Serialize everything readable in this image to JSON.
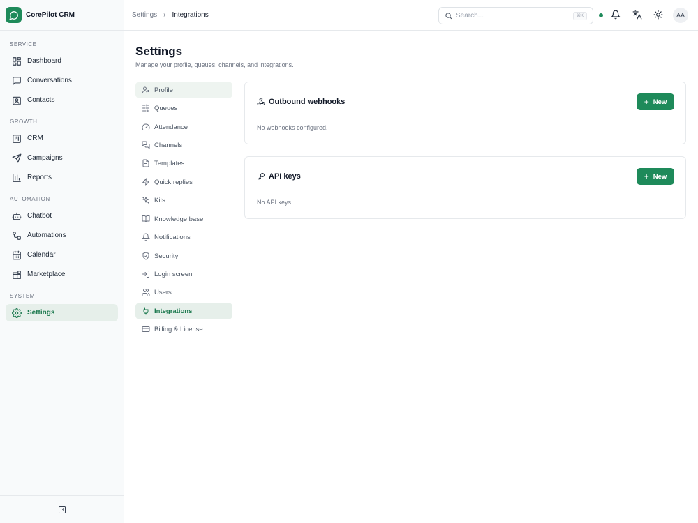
{
  "app": {
    "name": "CorePilot CRM"
  },
  "breadcrumb": [
    "Settings",
    "Integrations"
  ],
  "search": {
    "placeholder": "Search...",
    "shortcut": "⌘K"
  },
  "user": {
    "initials": "AA"
  },
  "sidebar": {
    "sections": [
      {
        "title": "SERVICE",
        "items": [
          {
            "label": "Dashboard",
            "icon": "grid-icon"
          },
          {
            "label": "Conversations",
            "icon": "message-icon"
          },
          {
            "label": "Contacts",
            "icon": "contact-card-icon"
          }
        ]
      },
      {
        "title": "GROWTH",
        "items": [
          {
            "label": "CRM",
            "icon": "kanban-icon"
          },
          {
            "label": "Campaigns",
            "icon": "send-icon"
          },
          {
            "label": "Reports",
            "icon": "bar-chart-icon"
          }
        ]
      },
      {
        "title": "AUTOMATION",
        "items": [
          {
            "label": "Chatbot",
            "icon": "bot-icon"
          },
          {
            "label": "Automations",
            "icon": "workflow-icon"
          },
          {
            "label": "Calendar",
            "icon": "calendar-icon"
          },
          {
            "label": "Marketplace",
            "icon": "blocks-icon"
          }
        ]
      },
      {
        "title": "SYSTEM",
        "items": [
          {
            "label": "Settings",
            "icon": "gear-icon",
            "active": true
          }
        ]
      }
    ]
  },
  "page": {
    "title": "Settings",
    "subtitle": "Manage your profile, queues, channels, and integrations."
  },
  "settings_nav": [
    {
      "label": "Profile",
      "icon": "user-icon"
    },
    {
      "label": "Queues",
      "icon": "sliders-icon"
    },
    {
      "label": "Attendance",
      "icon": "gauge-icon"
    },
    {
      "label": "Channels",
      "icon": "chat-bubbles-icon"
    },
    {
      "label": "Templates",
      "icon": "file-icon"
    },
    {
      "label": "Quick replies",
      "icon": "zap-icon"
    },
    {
      "label": "Kits",
      "icon": "sparkles-icon"
    },
    {
      "label": "Knowledge base",
      "icon": "book-icon"
    },
    {
      "label": "Notifications",
      "icon": "bell-icon"
    },
    {
      "label": "Security",
      "icon": "shield-icon"
    },
    {
      "label": "Login screen",
      "icon": "login-icon"
    },
    {
      "label": "Users",
      "icon": "users-icon"
    },
    {
      "label": "Integrations",
      "icon": "plug-icon",
      "active": true
    },
    {
      "label": "Billing & License",
      "icon": "credit-card-icon"
    }
  ],
  "cards": {
    "webhooks": {
      "title": "Outbound webhooks",
      "empty": "No webhooks configured.",
      "button": "New"
    },
    "api_keys": {
      "title": "API keys",
      "empty": "No API keys.",
      "button": "New"
    }
  },
  "colors": {
    "accent": "#1e8a5a",
    "active_bg": "#e6efea",
    "status": "#1e8a5a"
  }
}
